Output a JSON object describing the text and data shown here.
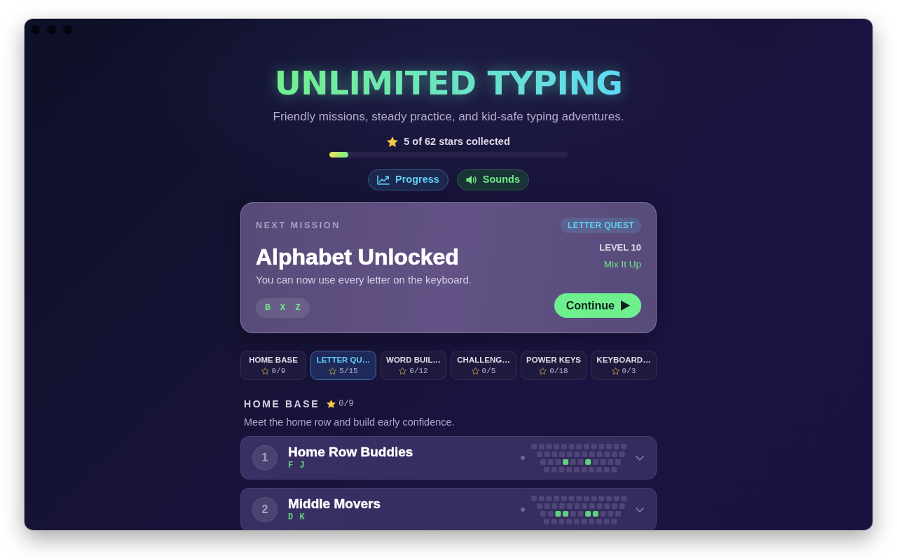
{
  "header": {
    "title": "UNLIMITED TYPING",
    "subtitle": "Friendly missions, steady practice, and kid-safe typing adventures.",
    "stars_summary": "5 of 62 stars collected",
    "stars_progress": {
      "level": 0.08
    }
  },
  "header_buttons": [
    {
      "kind": "progress",
      "label": "Progress"
    },
    {
      "kind": "sounds",
      "label": "Sounds"
    }
  ],
  "next_mission": {
    "eyebrow": "NEXT MISSION",
    "tag": "LETTER QUEST",
    "level_label": "LEVEL 10",
    "mode": "Mix It Up",
    "title": "Alphabet Unlocked",
    "description": "You can now use every letter on the keyboard.",
    "keys": [
      "B",
      "X",
      "Z"
    ],
    "action": "Continue"
  },
  "tabs": [
    {
      "label": "HOME BASE",
      "score": "0/9",
      "selected": false
    },
    {
      "label": "LETTER QU…",
      "score": "5/15",
      "selected": true
    },
    {
      "label": "WORD BUIL…",
      "score": "0/12",
      "selected": false
    },
    {
      "label": "CHALLENG…",
      "score": "0/5",
      "selected": false
    },
    {
      "label": "POWER KEYS",
      "score": "0/18",
      "selected": false
    },
    {
      "label": "KEYBOARD…",
      "score": "0/3",
      "selected": false
    }
  ],
  "section": {
    "title": "HOME BASE",
    "score": "0/9",
    "description": "Meet the home row and build early confidence."
  },
  "lessons": [
    {
      "number": "1",
      "title": "Home Row Buddies",
      "keys": [
        "F",
        "J"
      ],
      "done": false,
      "expanded": false,
      "home_row_lit": [
        false,
        false,
        false,
        true,
        false,
        false,
        true,
        false,
        false,
        false,
        false
      ]
    },
    {
      "number": "2",
      "title": "Middle Movers",
      "keys": [
        "D",
        "K"
      ],
      "done": false,
      "expanded": false,
      "home_row_lit": [
        false,
        false,
        true,
        true,
        false,
        false,
        true,
        true,
        false,
        false,
        false
      ]
    }
  ]
}
